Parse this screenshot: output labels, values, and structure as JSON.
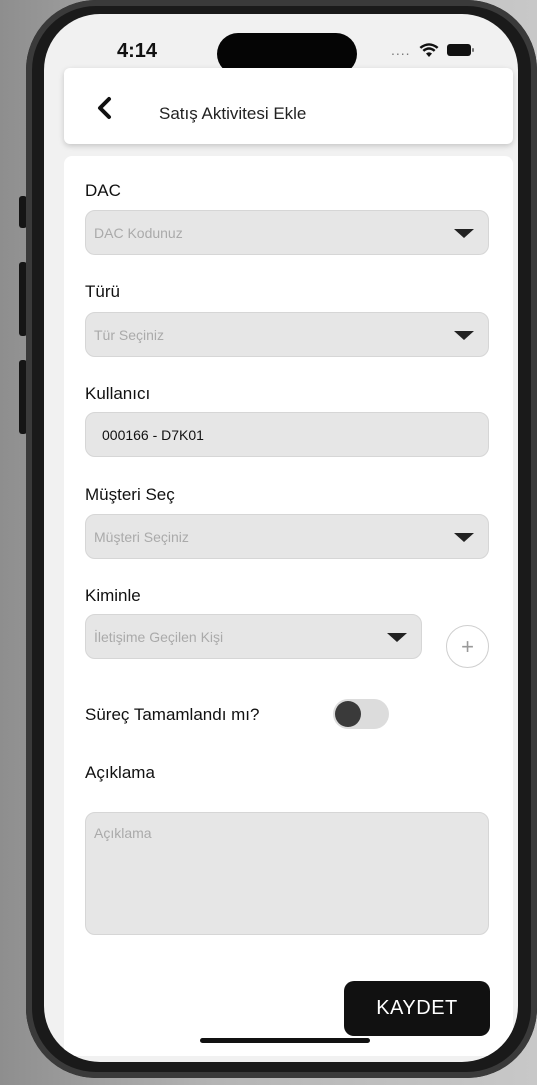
{
  "status_bar": {
    "time": "4:14",
    "signal": "...."
  },
  "header": {
    "title": "Satış Aktivitesi Ekle",
    "back_icon": "chevron-left-icon"
  },
  "form": {
    "dac": {
      "label": "DAC",
      "placeholder": "DAC Kodunuz"
    },
    "turu": {
      "label": "Türü",
      "placeholder": "Tür Seçiniz"
    },
    "kullanici": {
      "label": "Kullanıcı",
      "value": "000166 - D7K01"
    },
    "musteri": {
      "label": "Müşteri Seç",
      "placeholder": "Müşteri Seçiniz"
    },
    "kiminle": {
      "label": "Kiminle",
      "placeholder": "İletişime Geçilen Kişi",
      "add_icon": "plus-icon"
    },
    "surec": {
      "label": "Süreç Tamamlandı mı?",
      "checked": false
    },
    "aciklama": {
      "label": "Açıklama",
      "placeholder": "Açıklama"
    },
    "save_label": "KAYDET"
  },
  "colors": {
    "primary": "#111111",
    "field_bg": "#e6e6e6",
    "placeholder": "#aaaaaa"
  }
}
